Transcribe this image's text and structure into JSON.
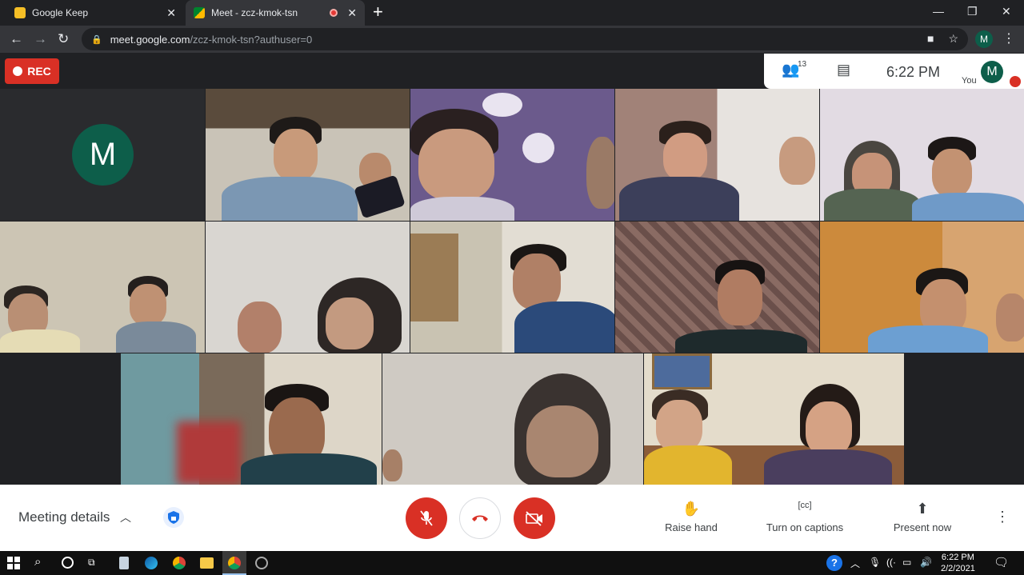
{
  "browser": {
    "tabs": [
      {
        "title": "Google Keep",
        "active": false
      },
      {
        "title": "Meet - zcz-kmok-tsn",
        "active": true,
        "recording": true
      }
    ],
    "url_host": "meet.google.com",
    "url_path": "/zcz-kmok-tsn?authuser=0",
    "profile_initial": "M"
  },
  "meet": {
    "rec_label": "REC",
    "participant_count": "13",
    "time": "6:22  PM",
    "self_label": "You",
    "self_initial": "M",
    "tile_avatar_initial": "M",
    "controls": {
      "meeting_details": "Meeting details",
      "raise_hand": "Raise hand",
      "captions": "Turn on captions",
      "present": "Present now"
    },
    "colors": {
      "red": "#d93025",
      "avatar": "#0d5e4a"
    }
  },
  "taskbar": {
    "time": "6:22 PM",
    "date": "2/2/2021"
  }
}
